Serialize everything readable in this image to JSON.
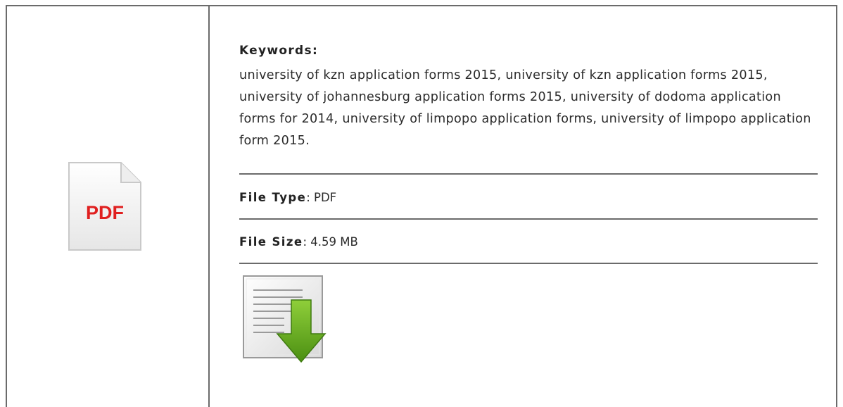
{
  "file_icon": {
    "label": "PDF",
    "icon": "pdf-file-icon",
    "label_color": "#e02020"
  },
  "keywords": {
    "label": "Keywords",
    "separator": ":",
    "text": "university of kzn application forms 2015, university of kzn application forms 2015, university of johannesburg application forms 2015, university of dodoma application forms for 2014, university of limpopo application forms, university of limpopo application form 2015."
  },
  "file_type": {
    "label": "File Type",
    "separator": ":",
    "value": "PDF"
  },
  "file_size": {
    "label": "File Size",
    "separator": ":",
    "value": "4.59 MB"
  },
  "download": {
    "icon": "download-icon",
    "arrow_color": "#6aa820"
  }
}
